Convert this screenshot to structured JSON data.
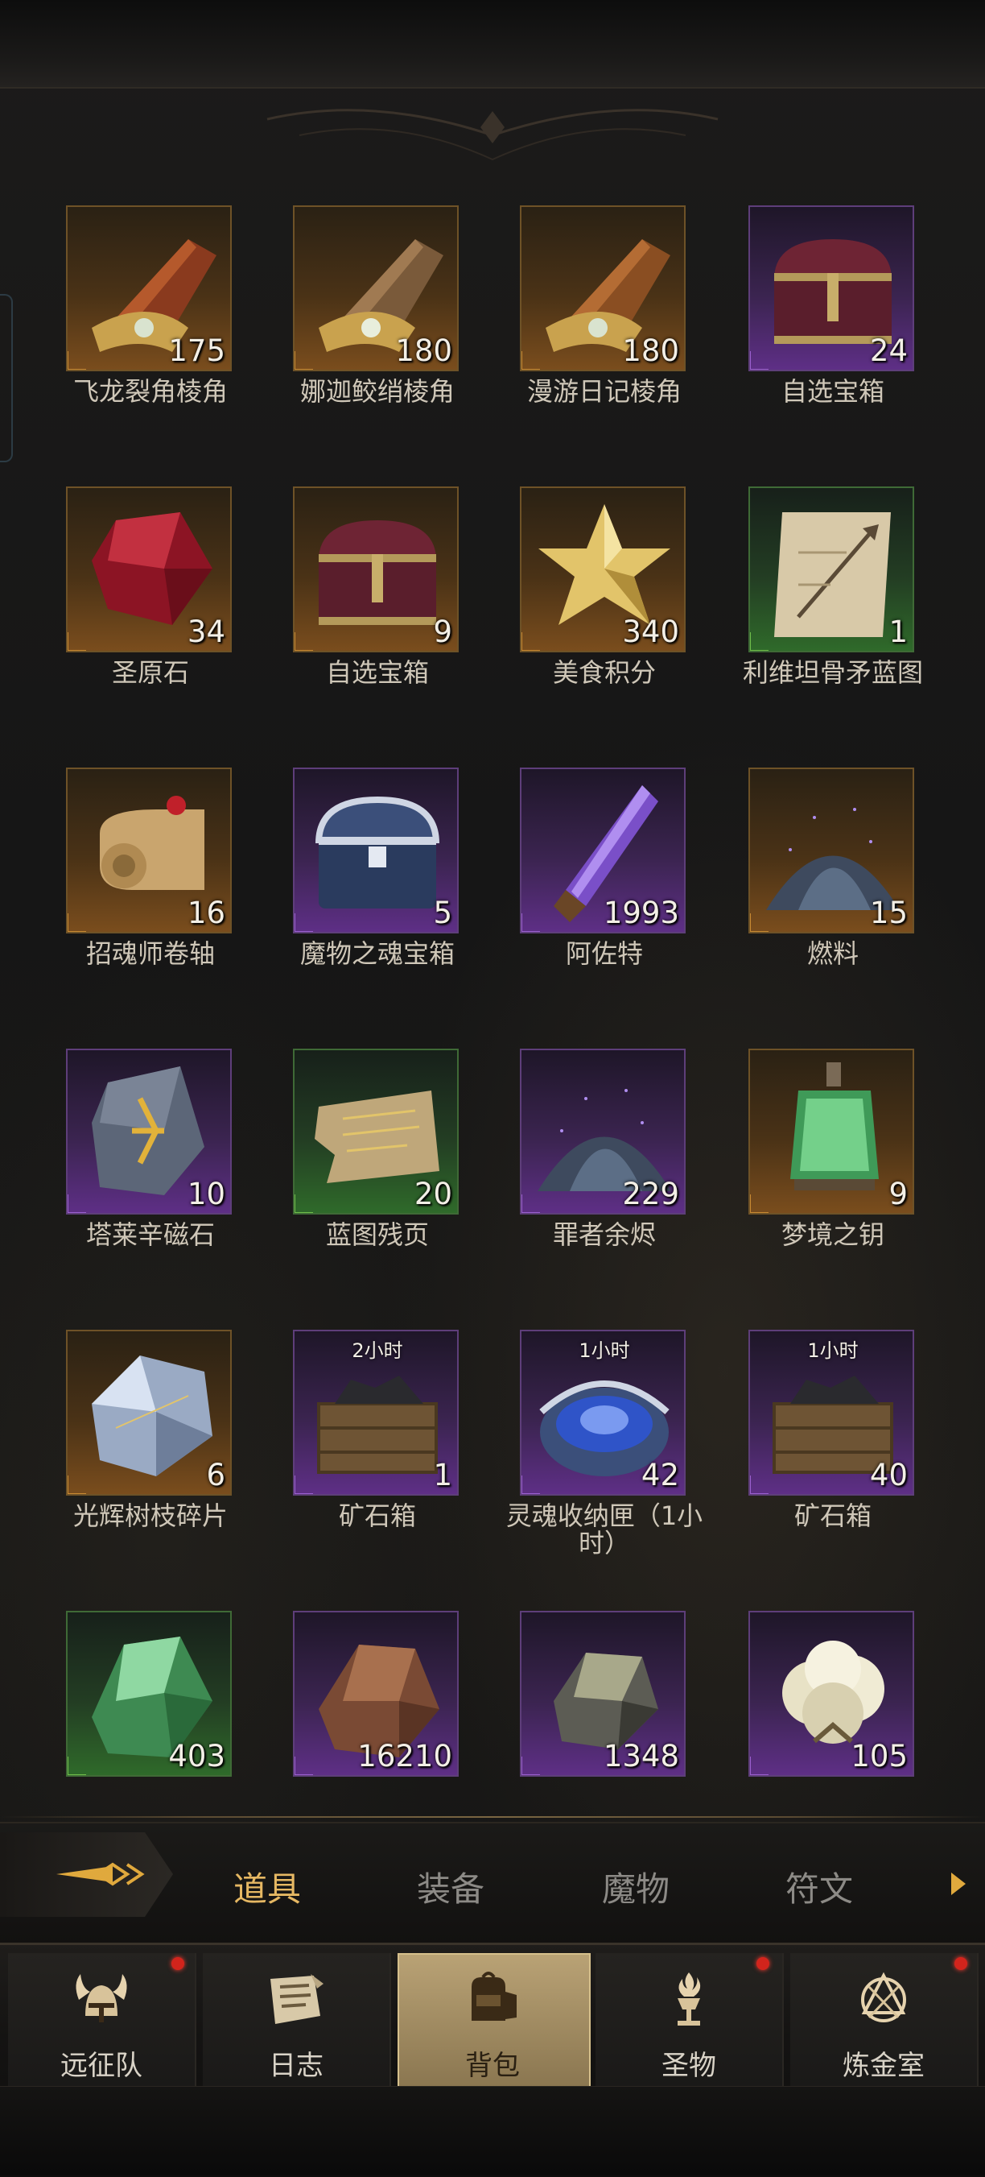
{
  "items": [
    {
      "name": "飞龙裂角棱角",
      "count": "175",
      "rarity": "orange",
      "icon": "horn-shard-red-icon",
      "timer": ""
    },
    {
      "name": "娜迦鲛绡棱角",
      "count": "180",
      "rarity": "orange",
      "icon": "horn-shard-bronze-icon",
      "timer": ""
    },
    {
      "name": "漫游日记棱角",
      "count": "180",
      "rarity": "orange",
      "icon": "horn-shard-copper-icon",
      "timer": ""
    },
    {
      "name": "自选宝箱",
      "count": "24",
      "rarity": "purple",
      "icon": "treasure-chest-icon",
      "timer": ""
    },
    {
      "name": "圣原石",
      "count": "34",
      "rarity": "orange",
      "icon": "red-gem-icon",
      "timer": ""
    },
    {
      "name": "自选宝箱",
      "count": "9",
      "rarity": "orange",
      "icon": "treasure-chest-icon",
      "timer": ""
    },
    {
      "name": "美食积分",
      "count": "340",
      "rarity": "orange",
      "icon": "gold-star-icon",
      "timer": ""
    },
    {
      "name": "利维坦骨矛蓝图",
      "count": "1",
      "rarity": "green",
      "icon": "blueprint-scroll-icon",
      "timer": ""
    },
    {
      "name": "招魂师卷轴",
      "count": "16",
      "rarity": "orange",
      "icon": "rolled-scroll-icon",
      "timer": ""
    },
    {
      "name": "魔物之魂宝箱",
      "count": "5",
      "rarity": "purple",
      "icon": "silver-chest-icon",
      "timer": ""
    },
    {
      "name": "阿佐特",
      "count": "1993",
      "rarity": "purple",
      "icon": "purple-crystal-vial-icon",
      "timer": ""
    },
    {
      "name": "燃料",
      "count": "15",
      "rarity": "orange",
      "icon": "dust-pile-icon",
      "timer": ""
    },
    {
      "name": "塔莱辛磁石",
      "count": "10",
      "rarity": "purple",
      "icon": "rune-stone-icon",
      "timer": ""
    },
    {
      "name": "蓝图残页",
      "count": "20",
      "rarity": "green",
      "icon": "torn-page-icon",
      "timer": ""
    },
    {
      "name": "罪者余烬",
      "count": "229",
      "rarity": "purple",
      "icon": "dust-pile-icon",
      "timer": ""
    },
    {
      "name": "梦境之钥",
      "count": "9",
      "rarity": "orange",
      "icon": "green-lantern-icon",
      "timer": ""
    },
    {
      "name": "光辉树枝碎片",
      "count": "6",
      "rarity": "orange",
      "icon": "crystal-shard-icon",
      "timer": ""
    },
    {
      "name": "矿石箱",
      "count": "1",
      "rarity": "purple",
      "icon": "ore-crate-icon",
      "timer": "2小时"
    },
    {
      "name": "灵魂收纳匣（1小时）",
      "count": "42",
      "rarity": "purple",
      "icon": "soul-casket-icon",
      "timer": "1小时"
    },
    {
      "name": "矿石箱",
      "count": "40",
      "rarity": "purple",
      "icon": "ore-crate-icon",
      "timer": "1小时"
    },
    {
      "name": "",
      "count": "403",
      "rarity": "green",
      "icon": "green-ore-icon",
      "timer": ""
    },
    {
      "name": "",
      "count": "16210",
      "rarity": "purple",
      "icon": "copper-ore-icon",
      "timer": ""
    },
    {
      "name": "",
      "count": "1348",
      "rarity": "purple",
      "icon": "gray-ore-icon",
      "timer": ""
    },
    {
      "name": "",
      "count": "105",
      "rarity": "purple",
      "icon": "cotton-icon",
      "timer": ""
    }
  ],
  "tabs": {
    "t0": "道具",
    "t1": "装备",
    "t2": "魔物",
    "t3": "符文"
  },
  "nav": {
    "n0": "远征队",
    "n1": "日志",
    "n2": "背包",
    "n3": "圣物",
    "n4": "炼金室"
  },
  "colors": {
    "orange": "#7a4d1d",
    "purple": "#5e2f86",
    "green": "#2f6a2a",
    "accent": "#e6b863",
    "badge": "#d2241c"
  }
}
